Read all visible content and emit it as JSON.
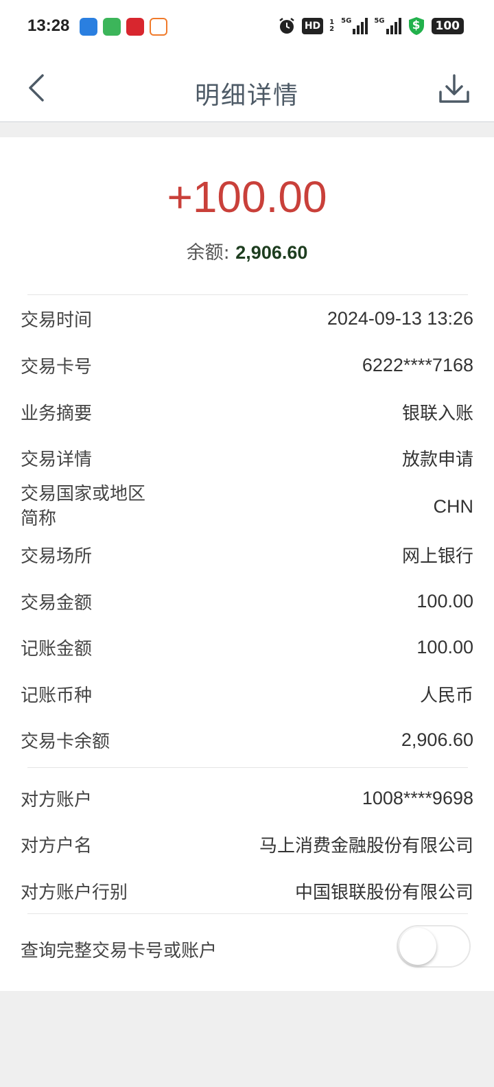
{
  "status_bar": {
    "time": "13:28",
    "hd_label": "HD",
    "hd_sub": "1 2",
    "net1": "5G",
    "net2": "5G",
    "shield_symbol": "$",
    "battery": "100",
    "app_icons": [
      "blue-app-icon",
      "green-chat-icon",
      "red-app-icon",
      "orange-app-icon"
    ]
  },
  "nav": {
    "title": "明细详情",
    "back_icon": "chevron-left-icon",
    "download_icon": "download-icon"
  },
  "summary": {
    "amount": "+100.00",
    "balance_label": "余额: ",
    "balance_value": "2,906.60",
    "amount_color": "#c9403a"
  },
  "details": [
    {
      "label": "交易时间",
      "value": "2024-09-13 13:26"
    },
    {
      "label": "交易卡号",
      "value": "6222****7168"
    },
    {
      "label": "业务摘要",
      "value": "银联入账"
    },
    {
      "label": "交易详情",
      "value": "放款申请"
    },
    {
      "label": "交易国家或地区简称",
      "value": "CHN"
    },
    {
      "label": "交易场所",
      "value": "网上银行"
    },
    {
      "label": "交易金额",
      "value": "100.00"
    },
    {
      "label": "记账金额",
      "value": "100.00"
    },
    {
      "label": "记账币种",
      "value": "人民币"
    },
    {
      "label": "交易卡余额",
      "value": "2,906.60"
    }
  ],
  "counterparty": [
    {
      "label": "对方账户",
      "value": "1008****9698"
    },
    {
      "label": "对方户名",
      "value": "马上消费金融股份有限公司"
    },
    {
      "label": "对方账户行别",
      "value": "中国银联股份有限公司"
    }
  ],
  "toggle": {
    "label": "查询完整交易卡号或账户",
    "state": "off"
  }
}
